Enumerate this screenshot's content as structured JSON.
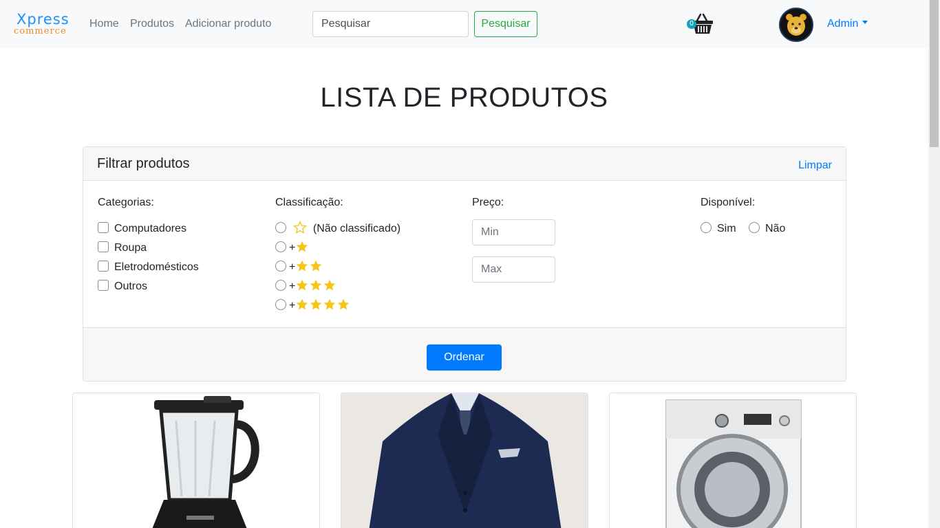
{
  "brand": {
    "line1": "Xpress",
    "line2": "commerce"
  },
  "nav": {
    "home": "Home",
    "products": "Produtos",
    "add_product": "Adicionar produto"
  },
  "search": {
    "placeholder": "Pesquisar",
    "button": "Pesquisar"
  },
  "cart": {
    "count": "0",
    "icon": "basket-icon"
  },
  "user": {
    "name": "Admin"
  },
  "page": {
    "title": "LISTA DE PRODUTOS"
  },
  "filter": {
    "title": "Filtrar produtos",
    "clear": "Limpar",
    "categories": {
      "label": "Categorias:",
      "items": [
        "Computadores",
        "Roupa",
        "Eletrodomésticos",
        "Outros"
      ]
    },
    "rating": {
      "label": "Classificação:",
      "unrated": "(Não classificado)",
      "prefix": "+",
      "levels": [
        1,
        2,
        3,
        4
      ]
    },
    "price": {
      "label": "Preço:",
      "min_placeholder": "Min",
      "max_placeholder": "Max"
    },
    "available": {
      "label": "Disponível:",
      "yes": "Sim",
      "no": "Não"
    },
    "order_button": "Ordenar"
  },
  "colors": {
    "primary": "#007bff",
    "success": "#28a745",
    "star": "#f5c518",
    "badge": "#17a2b8",
    "brand_blue": "#1e90ff",
    "brand_orange": "#f28c28"
  }
}
